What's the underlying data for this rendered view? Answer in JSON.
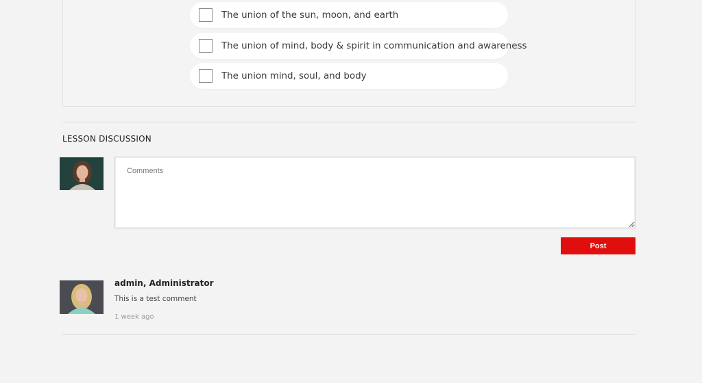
{
  "quiz": {
    "options": [
      "The union of the sun, moon, and earth",
      "The union of mind, body & spirit in communication and awareness",
      "The union mind, soul, and body"
    ]
  },
  "discussion": {
    "title": "LESSON DISCUSSION",
    "comment_placeholder": "Comments",
    "post_label": "Post",
    "accent_color": "#e10e0e"
  },
  "comments": [
    {
      "author": "admin, Administrator",
      "text": "This is a test comment",
      "time": "1 week ago"
    }
  ]
}
